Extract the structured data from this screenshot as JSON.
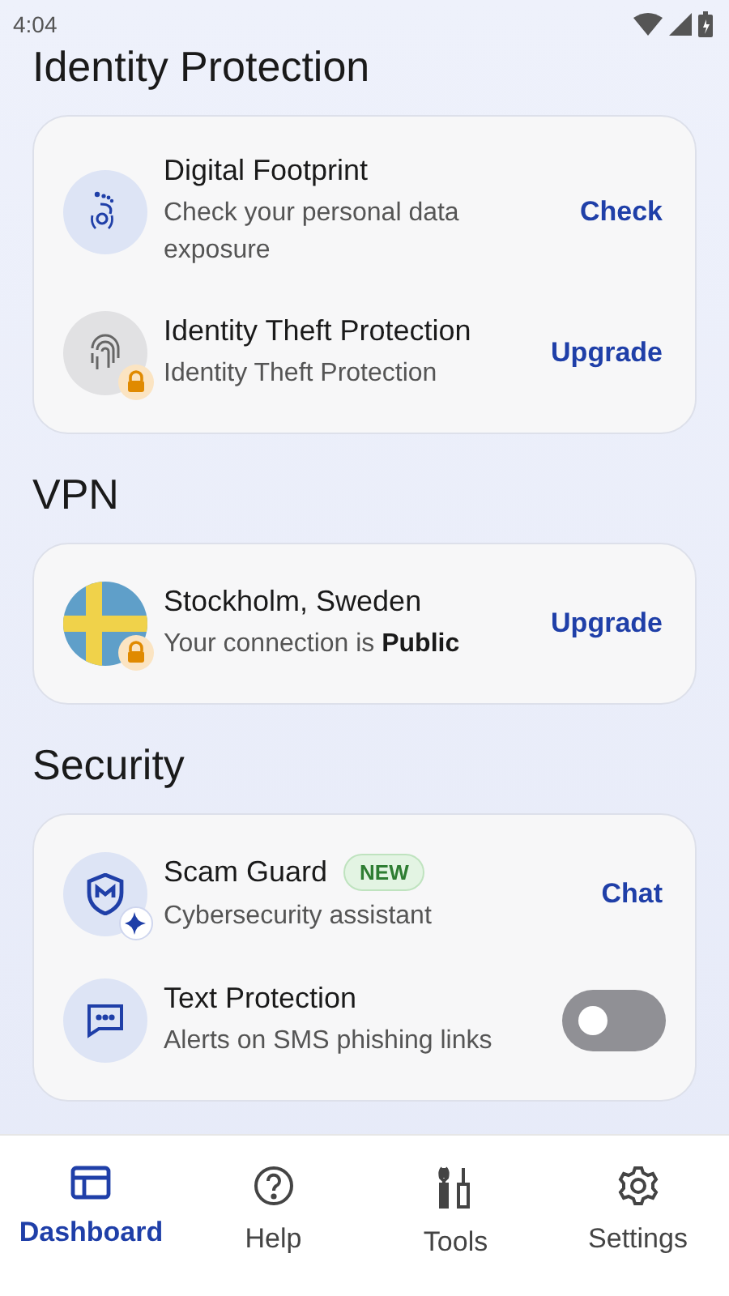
{
  "status_bar": {
    "time": "4:04"
  },
  "sections": [
    {
      "title": "Identity Protection",
      "items": [
        {
          "kind": "action",
          "title": "Digital Footprint",
          "subtitle": "Check your personal data exposure",
          "action": "Check",
          "locked": false
        },
        {
          "kind": "action",
          "title": "Identity Theft Protection",
          "subtitle": "Identity Theft Protection",
          "action": "Upgrade",
          "locked": true
        }
      ]
    },
    {
      "title": "VPN",
      "items": [
        {
          "kind": "action",
          "title": "Stockholm, Sweden",
          "subtitle": "Your connection is **Public**",
          "action": "Upgrade",
          "locked": true
        }
      ]
    },
    {
      "title": "Security",
      "items": [
        {
          "kind": "action",
          "title": "Scam Guard",
          "badge": "NEW",
          "subtitle": "Cybersecurity assistant",
          "action": "Chat",
          "locked": false
        },
        {
          "kind": "toggle",
          "title": "Text Protection",
          "subtitle": "Alerts on SMS phishing links",
          "on": false,
          "locked": false
        }
      ]
    }
  ],
  "nav": [
    {
      "label": "Dashboard",
      "selected": true
    },
    {
      "label": "Help",
      "selected": false
    },
    {
      "label": "Tools",
      "selected": false
    },
    {
      "label": "Settings",
      "selected": false
    }
  ]
}
